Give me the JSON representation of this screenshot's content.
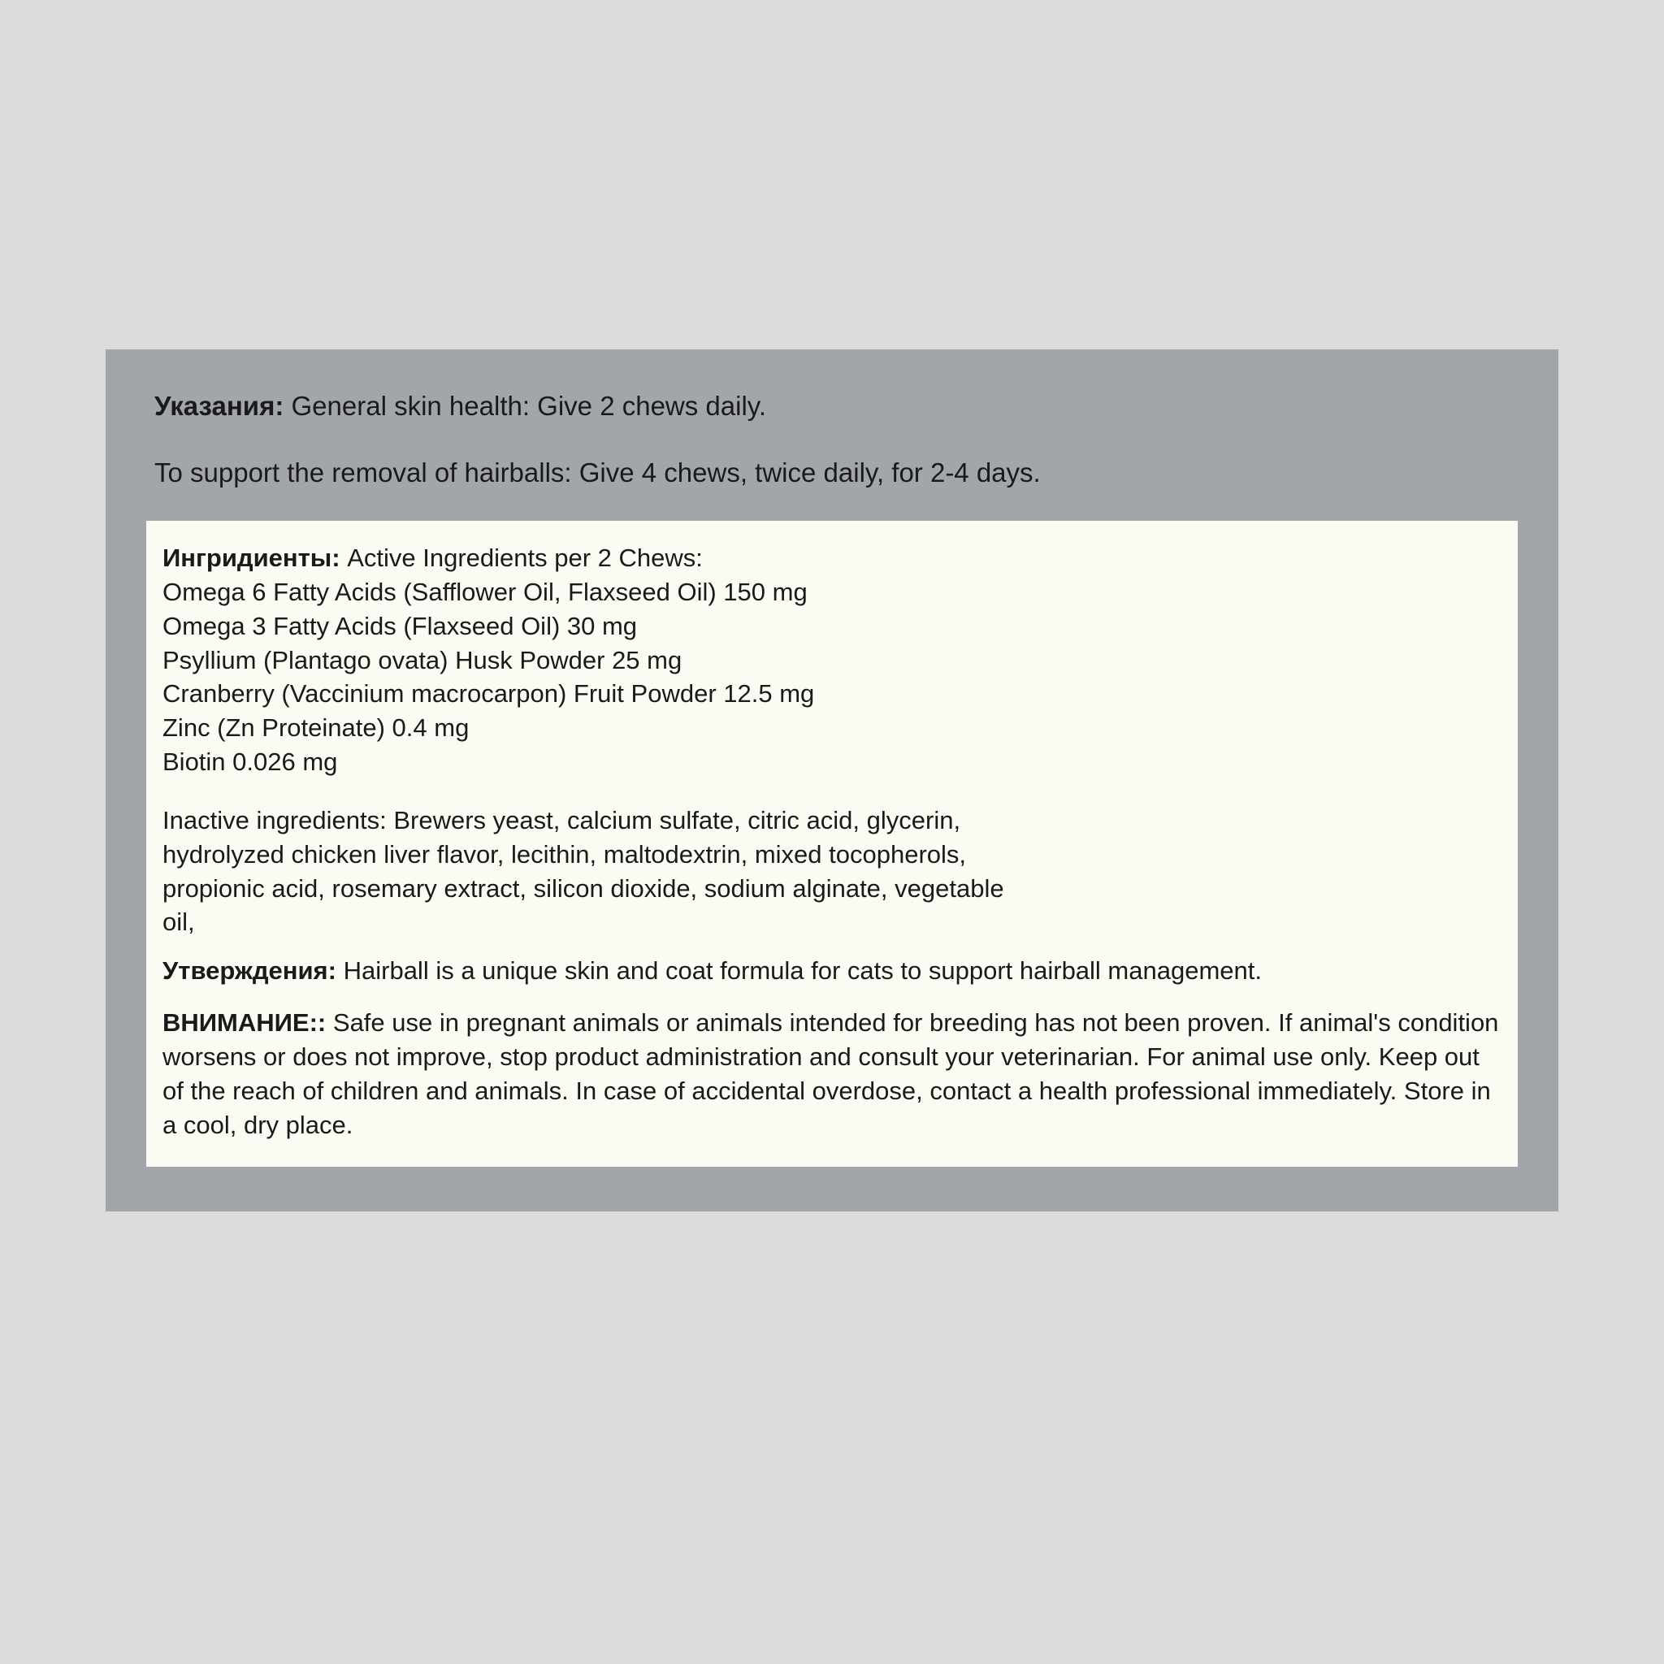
{
  "directions": {
    "label": "Указания:",
    "line1": "General skin health: Give 2 chews daily.",
    "line2": "To support the removal of hairballs: Give 4 chews, twice daily, for 2-4 days."
  },
  "ingredients": {
    "label": "Ингридиенты:",
    "intro": "Active Ingredients per 2 Chews:",
    "lines": [
      "Omega 6 Fatty Acids (Safflower Oil, Flaxseed Oil) 150 mg",
      "Omega 3 Fatty Acids (Flaxseed Oil) 30 mg",
      "Psyllium (Plantago ovata) Husk Powder 25 mg",
      "Cranberry (Vaccinium macrocarpon) Fruit Powder 12.5 mg",
      "Zinc (Zn Proteinate) 0.4 mg",
      "Biotin 0.026 mg"
    ]
  },
  "inactive": {
    "lines": [
      "Inactive ingredients: Brewers yeast, calcium sulfate, citric acid, glycerin,",
      "hydrolyzed chicken liver flavor, lecithin, maltodextrin, mixed tocopherols,",
      "propionic acid, rosemary extract, silicon dioxide, sodium alginate, vegetable",
      "oil,"
    ]
  },
  "claims": {
    "label": "Утверждения:",
    "text": "Hairball is a unique skin and coat formula for cats to support hairball management."
  },
  "warning": {
    "label": "ВНИМАНИЕ::",
    "text": "Safe use in pregnant animals or animals intended for breeding has not been proven. If animal's condition worsens or does not improve, stop product administration and consult your veterinarian. For animal use only. Keep out of the reach of children and animals. In case of accidental overdose, contact a health professional immediately. Store in a cool, dry place."
  }
}
